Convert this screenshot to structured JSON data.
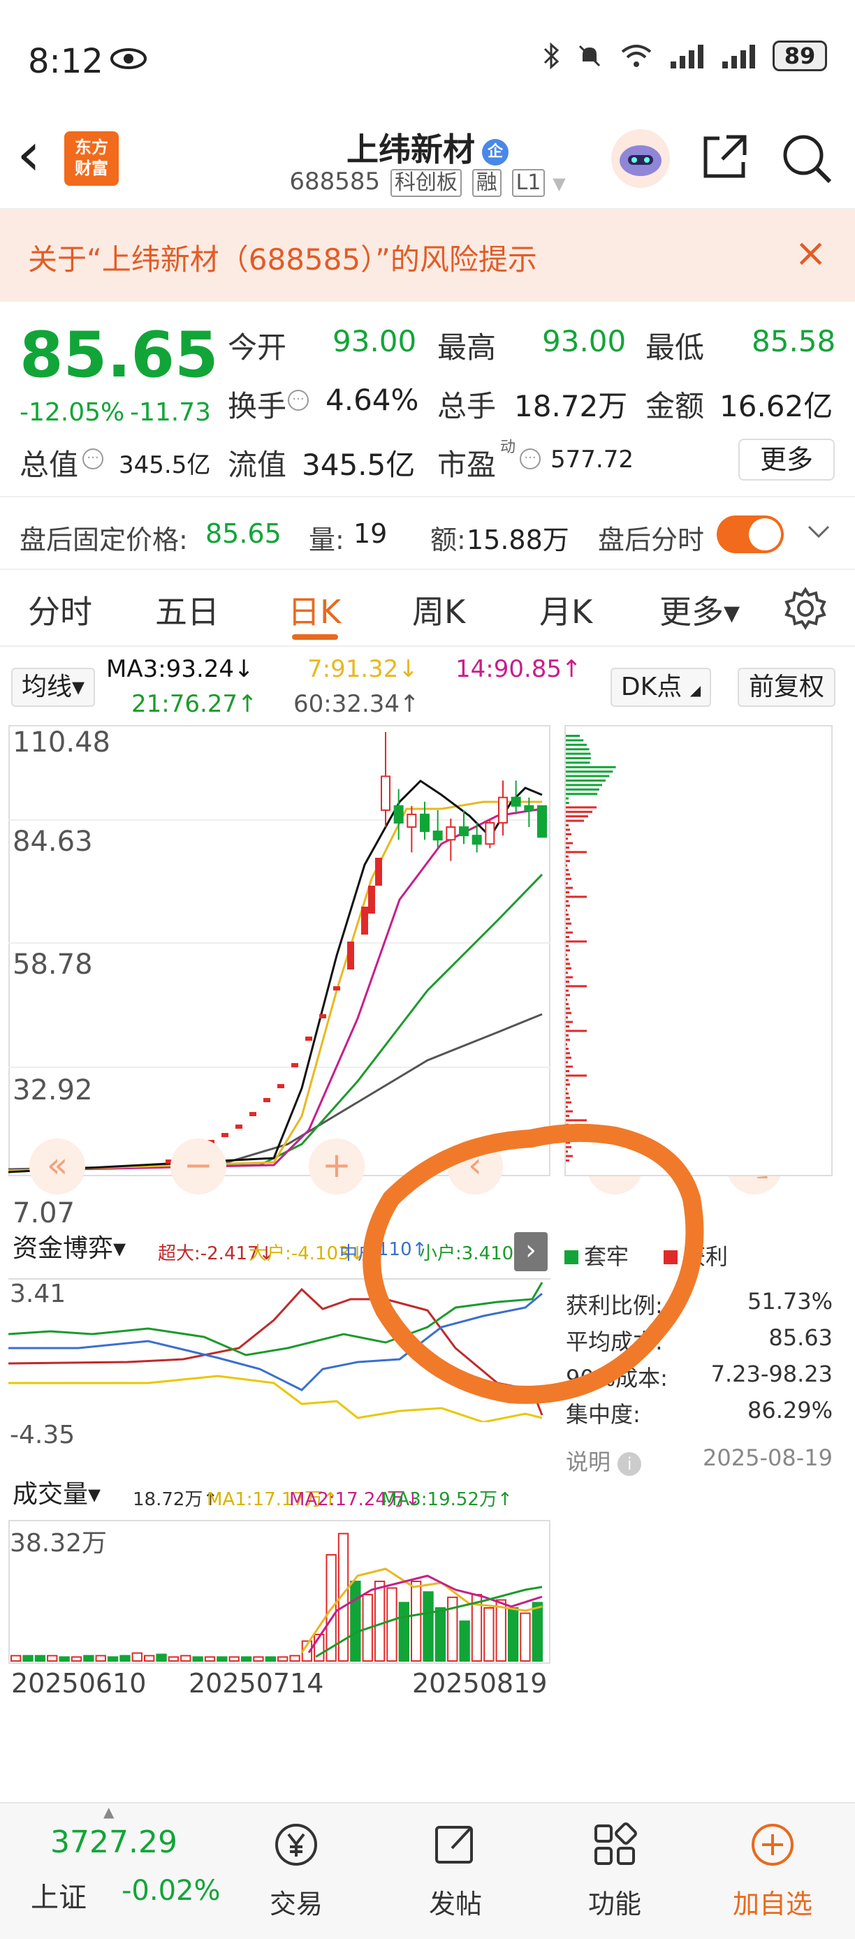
{
  "status_bar": {
    "time": "8:12",
    "battery": "89"
  },
  "header": {
    "back": "‹",
    "logo_line1": "东方",
    "logo_line2": "财富",
    "stock_name": "上纬新材",
    "enterprise_badge": "企",
    "stock_code": "688585",
    "board": "科创板",
    "margin": "融",
    "level": "L1"
  },
  "risk_banner": {
    "text": "关于“上纬新材（688585）”的风险提示",
    "close": "×"
  },
  "quote": {
    "price": "85.65",
    "change_pct": "-12.05%",
    "change": "-11.73",
    "open_label": "今开",
    "open": "93.00",
    "high_label": "最高",
    "high": "93.00",
    "low_label": "最低",
    "low": "85.58",
    "turnover_label": "换手",
    "turnover": "4.64%",
    "volume_label": "总手",
    "volume": "18.72万",
    "amount_label": "金额",
    "amount": "16.62亿",
    "total_value_label": "总值",
    "total_value": "345.5亿",
    "float_value_label": "流值",
    "float_value": "345.5亿",
    "pe_label": "市盈",
    "pe_sup": "动",
    "pe": "577.72",
    "more": "更多"
  },
  "after_hours": {
    "price_label": "盘后固定价格:",
    "price": "85.65",
    "vol_label": "量:",
    "vol": "19",
    "amt_label": "额:",
    "amt": "15.88万",
    "toggle_label": "盘后分时"
  },
  "tabs": [
    {
      "label": "分时"
    },
    {
      "label": "五日"
    },
    {
      "label": "日K"
    },
    {
      "label": "周K"
    },
    {
      "label": "月K"
    },
    {
      "label": "更多▾"
    }
  ],
  "chart_controls": {
    "ma_select": "均线▾",
    "ma3": "MA3:93.24↓",
    "ma7": "7:91.32↓",
    "ma14": "14:90.85↑",
    "ma21": "21:76.27↑",
    "ma60": "60:32.34↑",
    "dk": "DK点",
    "fq": "前复权"
  },
  "colors": {
    "up": "#e02a2a",
    "down": "#11a538",
    "accent": "#e86a1e",
    "ma3": "#111111",
    "ma7": "#e8b820",
    "ma14": "#c81e8c",
    "ma21": "#1c9a2c",
    "ma60": "#555555",
    "annotation": "#f07a2a"
  },
  "fund": {
    "select": "资金博弈▾",
    "super": "超大:-2.417↓",
    "big": "大户:-4.103↓",
    "mid": "中户",
    "mid_val": "110↑",
    "small": "小户:3.410↑",
    "max": "3.41",
    "min": "-4.35"
  },
  "chip": {
    "legend_trap": "套牢",
    "legend_profit": "获利",
    "profit_ratio_label": "获利比例:",
    "profit_ratio": "51.73%",
    "avg_cost_label": "平均成本:",
    "avg_cost": "85.63",
    "cost90_label": "90%成本:",
    "cost90": "7.23-98.23",
    "concentration_label": "集中度:",
    "concentration": "86.29%",
    "note_label": "说明",
    "date": "2025-08-19"
  },
  "volume": {
    "select": "成交量▾",
    "vol": "18.72万↑",
    "ma1": "MA1:17.17万↑",
    "ma2": "MA2:17.24万↓",
    "ma3": "MA3:19.52万↑",
    "max": "38.32万",
    "dates": [
      "20250610",
      "20250714",
      "20250819"
    ]
  },
  "chart_data": {
    "type": "candlestick",
    "price_ticks": [
      "110.48",
      "84.63",
      "58.78",
      "32.92",
      "7.07"
    ],
    "ylim": [
      7.07,
      110.48
    ],
    "candles": [
      {
        "o": 92,
        "h": 110.48,
        "l": 88,
        "c": 100
      },
      {
        "o": 93,
        "h": 97,
        "l": 85,
        "c": 89
      },
      {
        "o": 88,
        "h": 93,
        "l": 82,
        "c": 91
      },
      {
        "o": 91,
        "h": 94,
        "l": 85,
        "c": 87
      },
      {
        "o": 87,
        "h": 92,
        "l": 83,
        "c": 85
      },
      {
        "o": 85,
        "h": 90,
        "l": 80,
        "c": 88
      },
      {
        "o": 88,
        "h": 92,
        "l": 84,
        "c": 86
      },
      {
        "o": 86,
        "h": 89,
        "l": 82,
        "c": 84
      },
      {
        "o": 84,
        "h": 90,
        "l": 83,
        "c": 89
      },
      {
        "o": 89,
        "h": 99,
        "l": 86,
        "c": 95
      },
      {
        "o": 95,
        "h": 99,
        "l": 91,
        "c": 93
      },
      {
        "o": 93,
        "h": 95,
        "l": 88,
        "c": 92
      },
      {
        "o": 93,
        "h": 93,
        "l": 85.58,
        "c": 85.65
      }
    ],
    "fund_ylim": [
      -4.35,
      3.41
    ],
    "volume_ymax_label": "38.32万"
  },
  "nav": {
    "index_value": "3727.29",
    "index_name": "上证",
    "index_change": "-0.02%",
    "trade": "交易",
    "post": "发帖",
    "func": "功能",
    "add": "加自选"
  }
}
